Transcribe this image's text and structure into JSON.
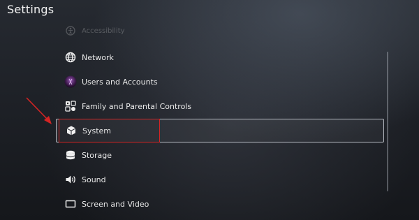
{
  "page": {
    "title": "Settings"
  },
  "menu": {
    "items": [
      {
        "label": "Accessibility",
        "icon": "accessibility-icon",
        "state": "faded"
      },
      {
        "label": "Network",
        "icon": "globe-icon",
        "state": "normal"
      },
      {
        "label": "Users and Accounts",
        "icon": "avatar-icon",
        "state": "normal"
      },
      {
        "label": "Family and Parental Controls",
        "icon": "family-icon",
        "state": "normal"
      },
      {
        "label": "System",
        "icon": "cube-icon",
        "state": "selected"
      },
      {
        "label": "Storage",
        "icon": "storage-icon",
        "state": "normal"
      },
      {
        "label": "Sound",
        "icon": "speaker-icon",
        "state": "normal"
      },
      {
        "label": "Screen and Video",
        "icon": "display-icon",
        "state": "normal"
      }
    ]
  },
  "annotation": {
    "highlight_color": "#d42424",
    "target": "System"
  },
  "colors": {
    "selection_border": "#b8bcc4",
    "text": "#e8e8e8"
  }
}
